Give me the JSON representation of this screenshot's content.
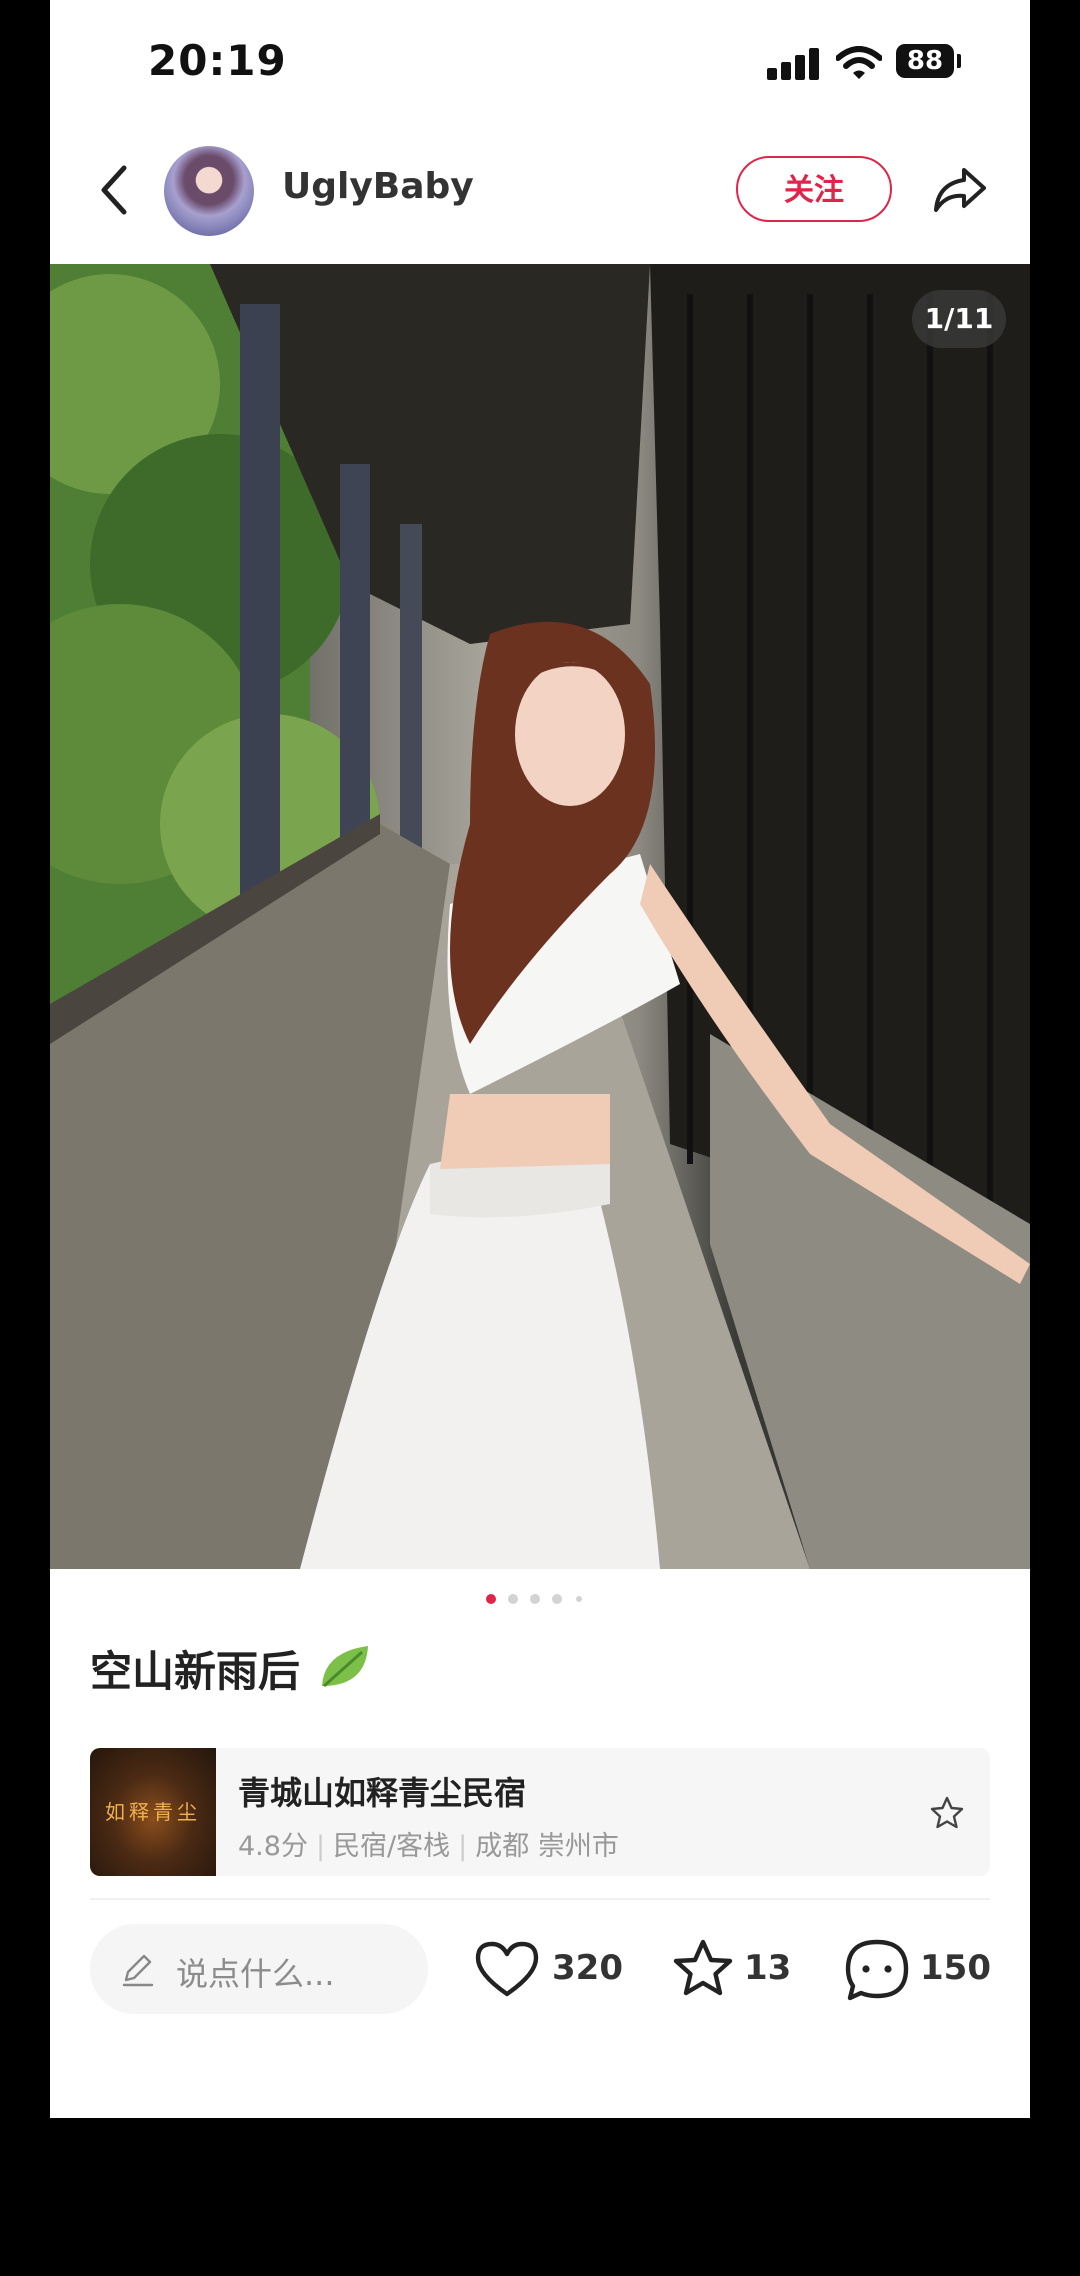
{
  "status_bar": {
    "time": "20:19",
    "battery": "88",
    "icons": [
      "signal-icon",
      "wifi-icon",
      "battery-icon"
    ]
  },
  "header": {
    "username": "UglyBaby",
    "follow_label": "关注",
    "icons": [
      "back-icon",
      "share-icon"
    ]
  },
  "photo": {
    "page_indicator": "1/11",
    "carousel_dots": 5,
    "active_dot": 0
  },
  "post": {
    "title": "空山新雨后",
    "title_icon": "leaf-icon"
  },
  "place": {
    "thumb_text": "如释青尘",
    "name": "青城山如释青尘民宿",
    "rating": "4.8分",
    "category": "民宿/客栈",
    "location": "成都 崇州市",
    "icon": "star-outline-icon"
  },
  "bottom_bar": {
    "comment_placeholder": "说点什么...",
    "likes": "320",
    "favorites": "13",
    "comments": "150"
  },
  "colors": {
    "accent": "#e0244a",
    "text_primary": "#222222",
    "text_secondary": "#999999"
  }
}
